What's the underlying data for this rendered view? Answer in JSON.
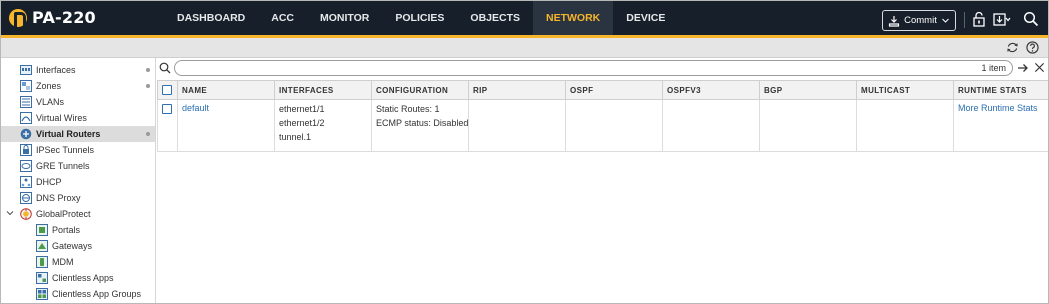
{
  "app": {
    "logo_text": "PA-220",
    "accent_color": "#f7b52b",
    "header_bg": "#161f2a"
  },
  "nav": {
    "tabs": [
      {
        "label": "DASHBOARD",
        "active": false
      },
      {
        "label": "ACC",
        "active": false
      },
      {
        "label": "MONITOR",
        "active": false
      },
      {
        "label": "POLICIES",
        "active": false
      },
      {
        "label": "OBJECTS",
        "active": false
      },
      {
        "label": "NETWORK",
        "active": true
      },
      {
        "label": "DEVICE",
        "active": false
      }
    ]
  },
  "header": {
    "commit_label": "Commit",
    "icons": [
      "commit-icon",
      "chevron-down-icon",
      "lock-icon",
      "config-download-icon",
      "search-icon"
    ]
  },
  "subbar": {
    "icons": [
      "refresh-icon",
      "help-icon"
    ]
  },
  "sidebar": {
    "items": [
      {
        "label": "Interfaces",
        "icon": "interfaces-icon",
        "dot": true
      },
      {
        "label": "Zones",
        "icon": "zones-icon",
        "dot": true
      },
      {
        "label": "VLANs",
        "icon": "vlans-icon",
        "dot": false
      },
      {
        "label": "Virtual Wires",
        "icon": "virtual-wires-icon",
        "dot": false
      },
      {
        "label": "Virtual Routers",
        "icon": "virtual-routers-icon",
        "dot": true,
        "active": true
      },
      {
        "label": "IPSec Tunnels",
        "icon": "ipsec-icon",
        "dot": false
      },
      {
        "label": "GRE Tunnels",
        "icon": "gre-icon",
        "dot": false
      },
      {
        "label": "DHCP",
        "icon": "dhcp-icon",
        "dot": false
      },
      {
        "label": "DNS Proxy",
        "icon": "dns-icon",
        "dot": false
      },
      {
        "label": "GlobalProtect",
        "icon": "globalprotect-icon",
        "dot": false,
        "expanded": true
      },
      {
        "label": "Portals",
        "icon": "portals-icon",
        "dot": false,
        "child": true
      },
      {
        "label": "Gateways",
        "icon": "gateways-icon",
        "dot": false,
        "child": true
      },
      {
        "label": "MDM",
        "icon": "mdm-icon",
        "dot": false,
        "child": true
      },
      {
        "label": "Clientless Apps",
        "icon": "clientless-apps-icon",
        "dot": false,
        "child": true
      },
      {
        "label": "Clientless App Groups",
        "icon": "clientless-app-groups-icon",
        "dot": false,
        "child": true
      }
    ]
  },
  "search": {
    "value": "",
    "placeholder": "",
    "item_count": "1 item"
  },
  "table": {
    "columns": [
      "NAME",
      "INTERFACES",
      "CONFIGURATION",
      "RIP",
      "OSPF",
      "OSPFV3",
      "BGP",
      "MULTICAST",
      "RUNTIME STATS"
    ],
    "rows": [
      {
        "name": "default",
        "interfaces": [
          "ethernet1/1",
          "ethernet1/2",
          "tunnel.1"
        ],
        "configuration": [
          "Static Routes: 1",
          "ECMP status: Disabled"
        ],
        "rip": "",
        "ospf": "",
        "ospfv3": "",
        "bgp": "",
        "multicast": "",
        "runtime_stats": "More Runtime Stats"
      }
    ]
  }
}
